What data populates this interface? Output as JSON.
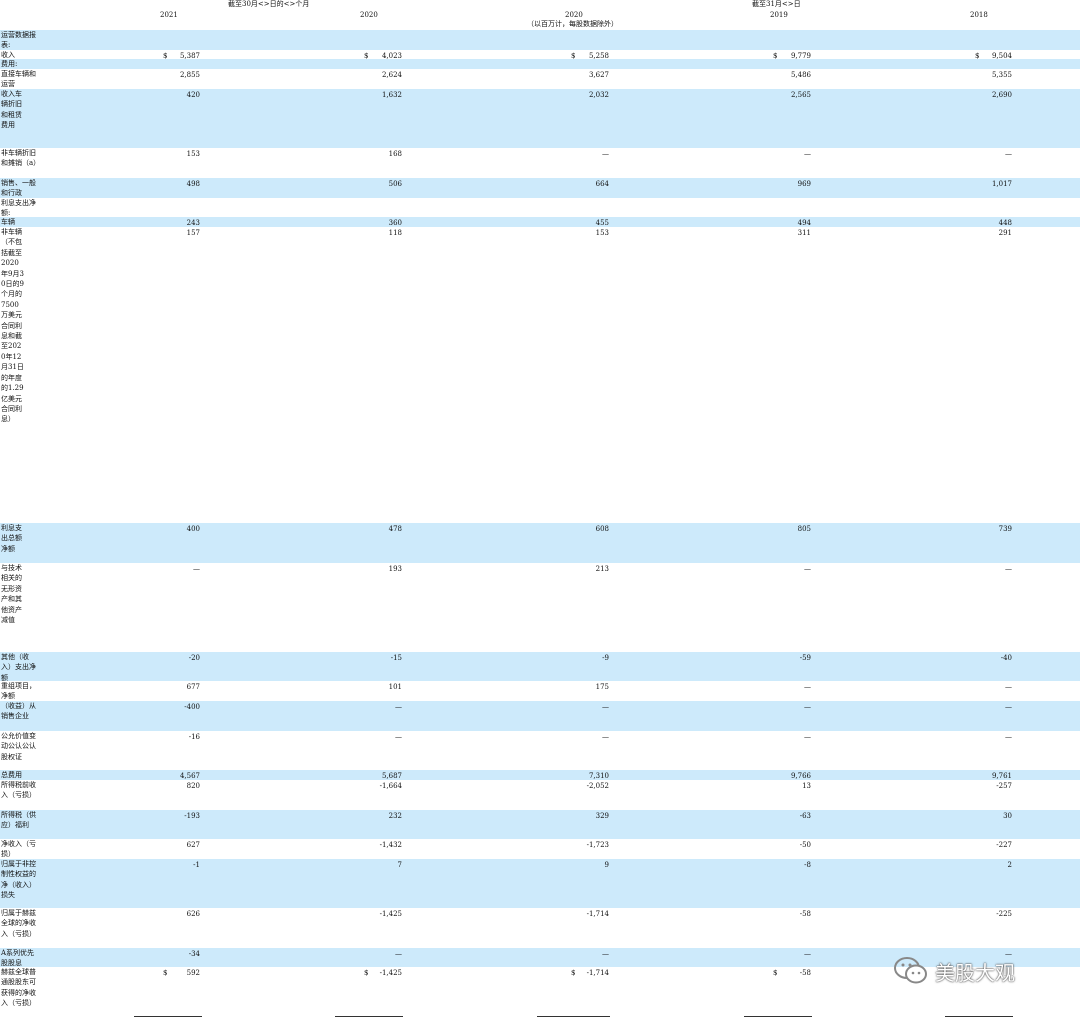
{
  "header": {
    "period_nine_months": "截至30月<>日的<>个月",
    "period_year_end": "截至31月<>日",
    "unit_note": "（以百万计，每股数据除外）",
    "years": [
      "2021",
      "2020",
      "2020",
      "2019",
      "2018"
    ]
  },
  "rows": [
    {
      "label": "运营数据报表:",
      "values": [
        "",
        "",
        "",
        "",
        ""
      ],
      "shade": true
    },
    {
      "label": "收入",
      "values": [
        "5,387",
        "4,023",
        "5,258",
        "9,779",
        "9,504"
      ],
      "dollar": true,
      "shade": false
    },
    {
      "label": "费用:",
      "values": [
        "",
        "",
        "",
        "",
        ""
      ],
      "shade": true
    },
    {
      "label": "直接车辆和运营",
      "values": [
        "2,855",
        "2,624",
        "3,627",
        "5,486",
        "5,355"
      ],
      "shade": false
    },
    {
      "label": "收入车辆折旧和租赁费用",
      "values": [
        "420",
        "1,632",
        "2,032",
        "2,565",
        "2,690"
      ],
      "shade": true
    },
    {
      "label": "非车辆折旧和摊销（a）",
      "values": [
        "153",
        "168",
        "—",
        "—",
        "—"
      ],
      "shade": false
    },
    {
      "label": "销售、一般和行政",
      "values": [
        "498",
        "506",
        "664",
        "969",
        "1,017"
      ],
      "shade": true
    },
    {
      "label": "利息支出净额:",
      "values": [
        "",
        "",
        "",
        "",
        ""
      ],
      "shade": false
    },
    {
      "label": "车辆",
      "values": [
        "243",
        "360",
        "455",
        "494",
        "448"
      ],
      "shade": true
    },
    {
      "label": "非车辆（不包括截至2020年9月30日的9个月的7500万美元合同利息和截至2020年12月31日的年度的1.29亿美元合同利息）",
      "values": [
        "157",
        "118",
        "153",
        "311",
        "291"
      ],
      "shade": false
    },
    {
      "label": "利息支出总额净额",
      "values": [
        "400",
        "478",
        "608",
        "805",
        "739"
      ],
      "shade": true
    },
    {
      "label": "与技术相关的无形资产和其他资产减值",
      "values": [
        "—",
        "193",
        "213",
        "—",
        "—"
      ],
      "shade": false
    },
    {
      "label": "其他（收入）支出净额",
      "values": [
        "-20",
        "-15",
        "-9",
        "-59",
        "-40"
      ],
      "shade": true
    },
    {
      "label": "重组项目，净额",
      "values": [
        "677",
        "101",
        "175",
        "—",
        "—"
      ],
      "shade": false
    },
    {
      "label": "（收益）从销售企业",
      "values": [
        "-400",
        "—",
        "—",
        "—",
        "—"
      ],
      "shade": true
    },
    {
      "label": "公允价值变动公认公认股权证",
      "values": [
        "-16",
        "—",
        "—",
        "—",
        "—"
      ],
      "shade": false
    },
    {
      "label": "总费用",
      "values": [
        "4,567",
        "5,687",
        "7,310",
        "9,766",
        "9,761"
      ],
      "shade": true
    },
    {
      "label": "所得税前收入（亏损）",
      "values": [
        "820",
        "-1,664",
        "-2,052",
        "13",
        "-257"
      ],
      "shade": false
    },
    {
      "label": "所得税（供应）福利",
      "values": [
        "-193",
        "232",
        "329",
        "-63",
        "30"
      ],
      "shade": true
    },
    {
      "label": "净收入（亏损）",
      "values": [
        "627",
        "-1,432",
        "-1,723",
        "-50",
        "-227"
      ],
      "shade": false
    },
    {
      "label": "归属于非控制性权益的净（收入）损失",
      "values": [
        "-1",
        "7",
        "9",
        "-8",
        "2"
      ],
      "shade": true
    },
    {
      "label": "归属于赫兹全球的净收入（亏损）",
      "values": [
        "626",
        "-1,425",
        "-1,714",
        "-58",
        "-225"
      ],
      "shade": false
    },
    {
      "label": "A系列优先股股息",
      "values": [
        "-34",
        "—",
        "—",
        "—",
        "—"
      ],
      "shade": true
    },
    {
      "label": "赫兹全球普通股股东可获得的净收入（亏损）",
      "values": [
        "592",
        "-1,425",
        "-1,714",
        "-58",
        ""
      ],
      "dollar": true,
      "shade": false
    }
  ],
  "dollar_sign": "$",
  "watermark": {
    "text": "美股大观",
    "icon": "wechat-icon"
  },
  "colors": {
    "row_shade": "#cdeafb"
  }
}
